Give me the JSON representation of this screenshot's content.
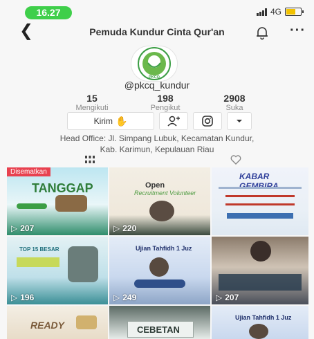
{
  "status": {
    "time": "16.27",
    "network": "4G"
  },
  "header": {
    "title": "Pemuda Kundur Cinta Qur'an"
  },
  "profile": {
    "username": "@pkcq_kundur",
    "avatar_text": "PKCQ",
    "stats": [
      {
        "value": "15",
        "label": "Mengikuti"
      },
      {
        "value": "198",
        "label": "Pengikut"
      },
      {
        "value": "2908",
        "label": "Suka"
      }
    ],
    "send_label": "Kirim",
    "bio_line1": "Head Office: Jl. Simpang Lubuk, Kecamatan Kundur,",
    "bio_line2": "Kab. Karimun, Kepulauan Riau"
  },
  "videos": [
    {
      "views": "207",
      "pinned_label": "Disematkan",
      "title": "TANGGAP"
    },
    {
      "views": "220",
      "title": "Open",
      "subtitle": "Recruitment Volunteer"
    },
    {
      "views": "",
      "title": "KABAR GEMBIRA"
    },
    {
      "views": "196",
      "title": "TOP 15 BESAR"
    },
    {
      "views": "249",
      "title": "Ujian Tahfidh 1 Juz"
    },
    {
      "views": "207",
      "title": ""
    },
    {
      "views": "",
      "title": "READY"
    },
    {
      "views": "",
      "title": "CEBETAN"
    },
    {
      "views": "",
      "title": "Ujian Tahfidh 1 Juz"
    }
  ],
  "colors": {
    "time_pill": "#3fcf4a",
    "pinned": "#e8414f",
    "accent_green": "#3c9e45"
  }
}
